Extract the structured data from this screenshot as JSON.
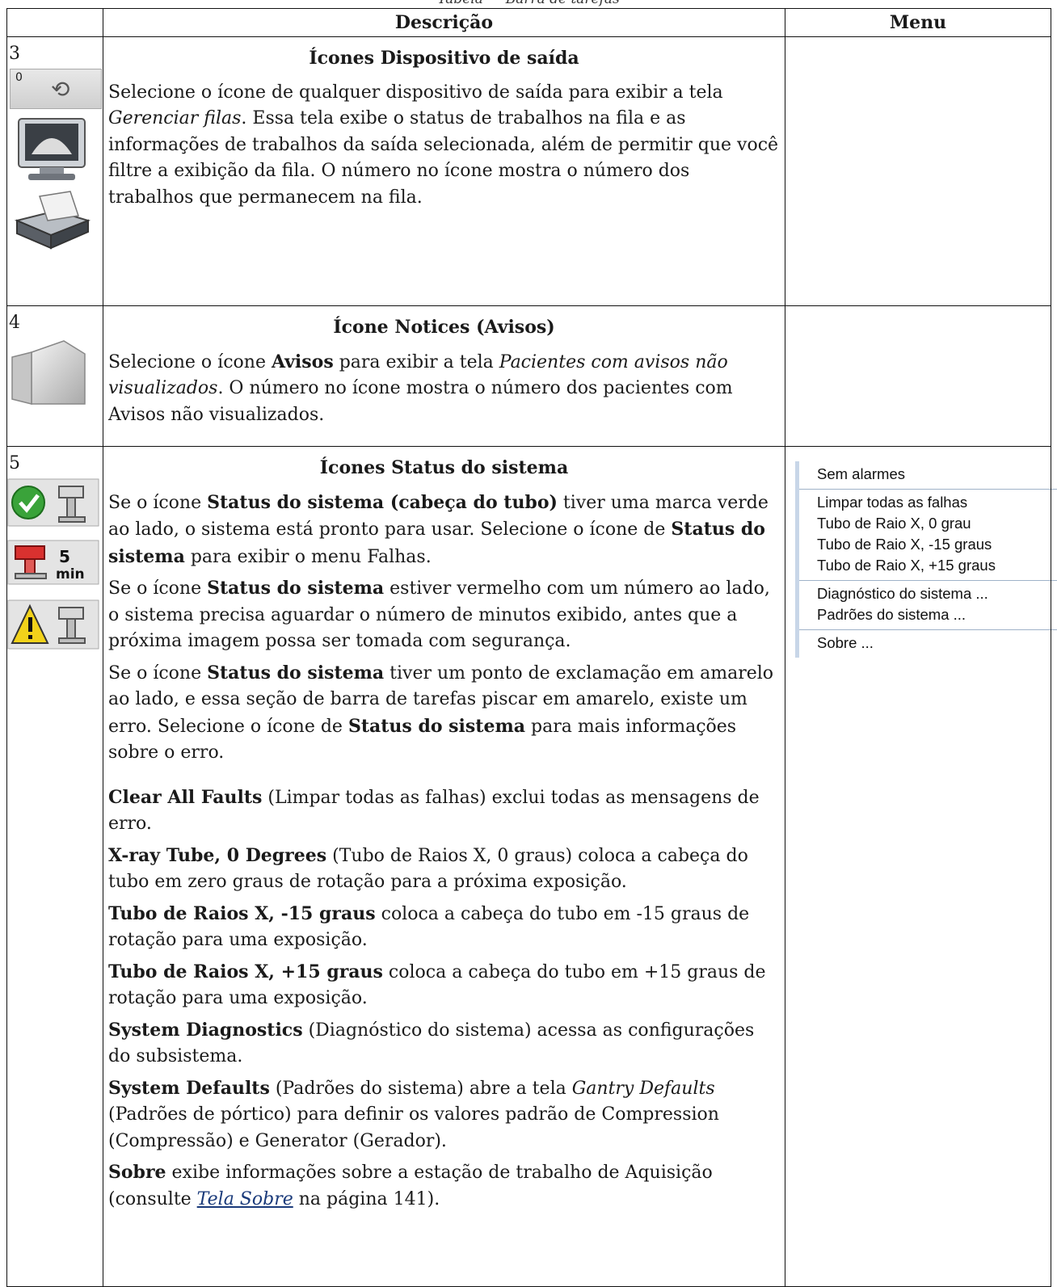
{
  "caption": "Tabela — Barra de tarefas",
  "headers": {
    "col1": "",
    "col2": "Descrição",
    "col3": "Menu"
  },
  "rows": [
    {
      "number": "3",
      "title": "Ícones Dispositivo de saída",
      "icons": [
        "output-queue-icon",
        "monitor-icon",
        "printer-icon"
      ],
      "queue_badge": "0",
      "p1_a": "Selecione o ícone de qualquer dispositivo de saída para exibir a tela ",
      "p1_b": "Gerenciar filas",
      "p1_c": ". Essa tela exibe o status de trabalhos na fila e as informações de trabalhos da saída selecionada, além de permitir que você filtre a exibição da fila. O número no ícone mostra o número dos trabalhos que permanecem na fila."
    },
    {
      "number": "4",
      "title": "Ícone Notices (Avisos)",
      "icons": [
        "notepad-icon"
      ],
      "p1_a": "Selecione o ícone ",
      "p1_b": "Avisos",
      "p1_c": " para exibir a tela ",
      "p1_d": "Pacientes com avisos não visualizados",
      "p1_e": ". O número no ícone mostra o número dos pacientes com Avisos não visualizados."
    },
    {
      "number": "5",
      "title": "Ícones Status do sistema",
      "icons": [
        "ready-check-icon",
        "wait-timer-icon",
        "warning-icon"
      ],
      "timer_text": "5",
      "timer_unit": "min",
      "paras": {
        "s1a": "Se o ícone ",
        "s1b": "Status do sistema (cabeça do tubo)",
        "s1c": " tiver uma marca verde ao lado, o sistema está pronto para usar. Selecione o ícone de ",
        "s1d": "Status do sistema",
        "s1e": " para exibir o menu Falhas.",
        "s2a": "Se o ícone ",
        "s2b": "Status do sistema",
        "s2c": " estiver vermelho com um número ao lado, o sistema precisa aguardar o número de minutos exibido, antes que a próxima imagem possa ser tomada com segurança.",
        "s3a": "Se o ícone ",
        "s3b": "Status do sistema",
        "s3c": " tiver um ponto de exclamação em amarelo ao lado, e essa seção de barra de tarefas piscar em amarelo, existe um erro. Selecione o ícone de ",
        "s3d": "Status do sistema",
        "s3e": " para mais informações sobre o erro.",
        "d1a": "Clear All Faults",
        "d1b": " (Limpar todas as falhas) exclui todas as mensagens de erro.",
        "d2a": "X-ray Tube, 0 Degrees",
        "d2b": " (Tubo de Raios X, 0 graus) coloca a cabeça do tubo em zero graus de rotação para a próxima exposição.",
        "d3a": "Tubo de Raios X, -15 graus",
        "d3b": " coloca a cabeça do tubo em -15 graus de rotação para uma exposição.",
        "d4a": "Tubo de Raios X, +15 graus",
        "d4b": " coloca a cabeça do tubo em +15 graus de rotação para uma exposição.",
        "d5a": "System Diagnostics",
        "d5b": " (Diagnóstico do sistema) acessa as configurações do subsistema.",
        "d6a": "System Defaults",
        "d6b": " (Padrões do sistema) abre a tela ",
        "d6c": "Gantry Defaults",
        "d6d": " (Padrões de pórtico) para definir os valores padrão de Compression (Compressão) e Generator (Gerador).",
        "d7a": "Sobre",
        "d7b": " exibe informações sobre a estação de trabalho de Aquisição (consulte ",
        "d7c": "Tela Sobre",
        "d7d": " na página 141)."
      },
      "menu": {
        "g1": [
          "Sem alarmes"
        ],
        "g2": [
          "Limpar todas as falhas",
          "Tubo de Raio X, 0 grau",
          "Tubo de Raio X, -15 graus",
          "Tubo de Raio X, +15 graus"
        ],
        "g3": [
          "Diagnóstico do sistema ...",
          "Padrões do sistema ..."
        ],
        "g4": [
          "Sobre ..."
        ]
      }
    }
  ]
}
